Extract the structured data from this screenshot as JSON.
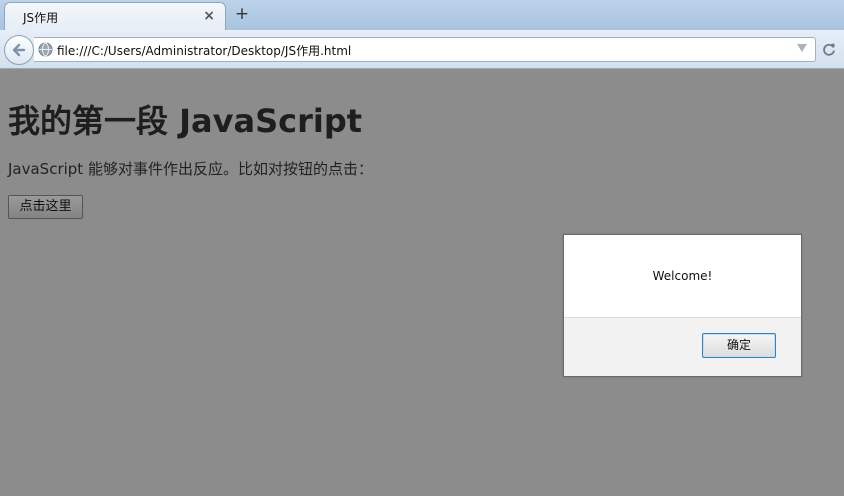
{
  "browser": {
    "tab_title": "JS作用",
    "tab_close": "×",
    "new_tab": "+",
    "address": "file:///C:/Users/Administrator/Desktop/JS作用.html"
  },
  "page": {
    "heading": "我的第一段 JavaScript",
    "paragraph": "JavaScript 能够对事件作出反应。比如对按钮的点击：",
    "button_label": "点击这里"
  },
  "alert": {
    "message": "Welcome!",
    "ok_label": "确定"
  }
}
